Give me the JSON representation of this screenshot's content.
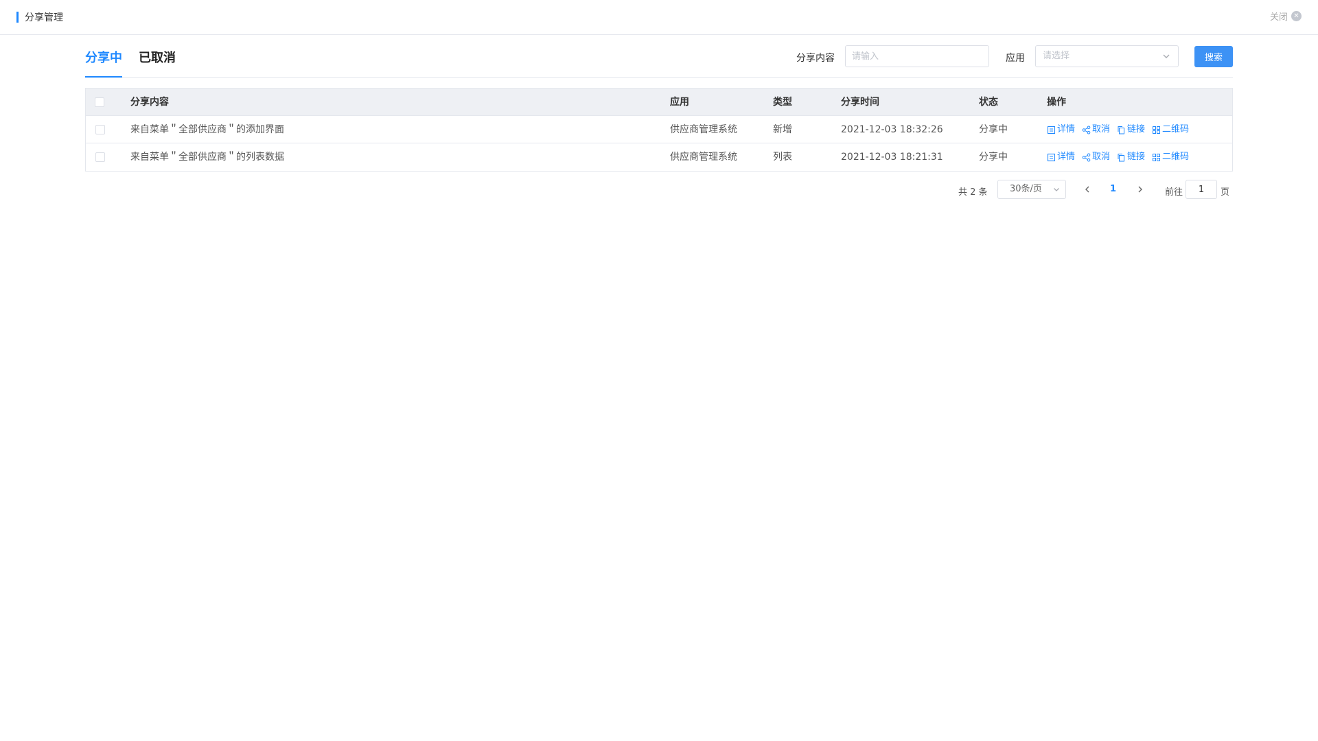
{
  "header": {
    "title": "分享管理",
    "close_label": "关闭"
  },
  "tabs": [
    {
      "label": "分享中",
      "active": true
    },
    {
      "label": "已取消",
      "active": false
    }
  ],
  "filters": {
    "content_label": "分享内容",
    "content_placeholder": "请输入",
    "app_label": "应用",
    "app_placeholder": "请选择",
    "search_button": "搜索"
  },
  "table": {
    "columns": [
      "分享内容",
      "应用",
      "类型",
      "分享时间",
      "状态",
      "操作"
    ],
    "rows": [
      {
        "content": "来自菜单＂全部供应商＂的添加界面",
        "app": "供应商管理系统",
        "type": "新增",
        "time": "2021-12-03 18:32:26",
        "status": "分享中"
      },
      {
        "content": "来自菜单＂全部供应商＂的列表数据",
        "app": "供应商管理系统",
        "type": "列表",
        "time": "2021-12-03 18:21:31",
        "status": "分享中"
      }
    ],
    "actions": {
      "detail": "详情",
      "cancel": "取消",
      "link": "链接",
      "qrcode": "二维码"
    }
  },
  "pagination": {
    "total_text": "共 2 条",
    "page_size": "30条/页",
    "current_page": "1",
    "goto_label": "前往",
    "goto_value": "1",
    "page_unit": "页"
  },
  "colors": {
    "accent": "#1e88ff",
    "header_bg": "#eef0f4"
  }
}
